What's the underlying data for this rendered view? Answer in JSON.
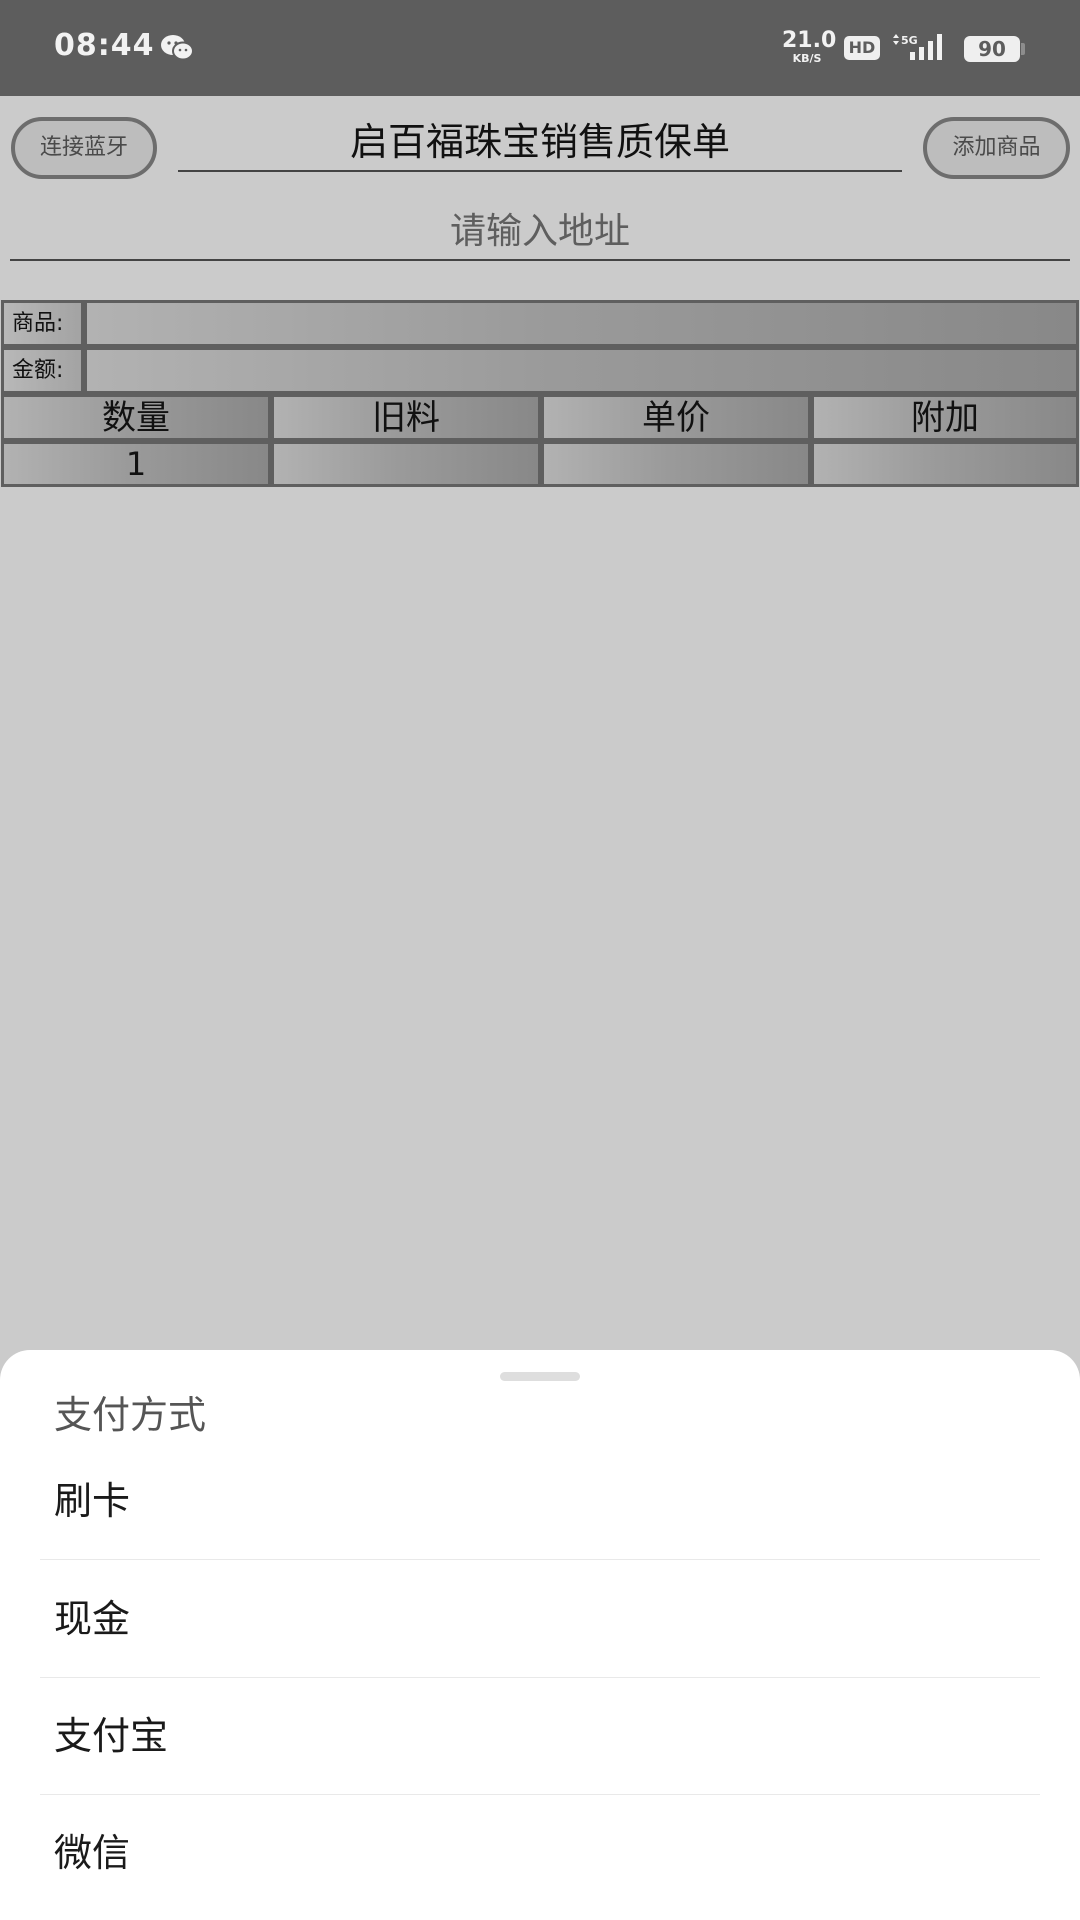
{
  "status_bar": {
    "time": "08:44",
    "net_speed_value": "21.0",
    "net_speed_unit": "KB/S",
    "hd_label": "HD",
    "network_type": "5G",
    "battery": "90",
    "icons": [
      "wechat-icon",
      "signal-icon",
      "battery-icon"
    ]
  },
  "header": {
    "connect_bluetooth_label": "连接蓝牙",
    "title_value": "启百福珠宝销售质保单",
    "add_product_label": "添加商品",
    "address_placeholder": "请输入地址"
  },
  "form": {
    "product_label": "商品:",
    "product_value": "",
    "amount_label": "金额:",
    "amount_value": "",
    "columns": [
      "数量",
      "旧料",
      "单价",
      "附加"
    ],
    "values": [
      "1",
      "",
      "",
      ""
    ]
  },
  "payment_sheet": {
    "title": "支付方式",
    "options": [
      "刷卡",
      "现金",
      "支付宝",
      "微信"
    ]
  },
  "colors": {
    "status_bar_bg": "#5d5d5d",
    "page_bg": "#cbcbcb",
    "sheet_bg": "#ffffff"
  }
}
